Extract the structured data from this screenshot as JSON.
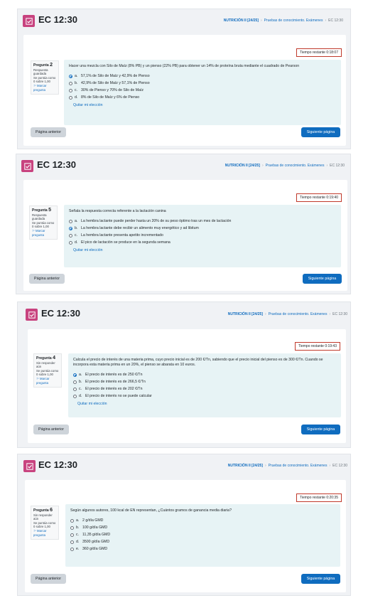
{
  "screens": [
    {
      "title": "EC 12:30",
      "breadcrumb": {
        "course": "NUTRICIÓN II [24/25]",
        "section": "Pruebas de conocimiento. Exámenes",
        "current": "EC 12:30"
      },
      "timer": "Tiempo restante 0:18:07",
      "info": {
        "label": "Pregunta",
        "number": "2",
        "status": "Respuesta guardada",
        "score": "Se puntúa como 0 sobre 1,00",
        "flag": "Marcar pregunta"
      },
      "question": "Hacer una mezcla con Silo de Maíz (8% PB) y un pienso (22% PB) para obtener un 14% de proteína bruta mediante el cuadrado de Pearson",
      "options": [
        {
          "letter": "a.",
          "text": "57,1% de Silo de Maíz y 42,9% de Pienso",
          "selected": true
        },
        {
          "letter": "b.",
          "text": "42,9% de Silo de Maíz y 57,1% de Pienso",
          "selected": false
        },
        {
          "letter": "c.",
          "text": "30% de Pienso y 70% de Silo de Maíz",
          "selected": false
        },
        {
          "letter": "d.",
          "text": "8% de Silo de Maíz y 6% de Pienso",
          "selected": false
        }
      ],
      "clear": "Quitar mi elección",
      "prev": "Página anterior",
      "next": "Siguiente página"
    },
    {
      "title": "EC 12:30",
      "breadcrumb": {
        "course": "NUTRICIÓN II [24/25]",
        "section": "Pruebas de conocimiento. Exámenes",
        "current": "EC 12:30"
      },
      "timer": "Tiempo restante 0:19:40",
      "info": {
        "label": "Pregunta",
        "number": "5",
        "status": "Respuesta guardada",
        "score": "Se puntúa como 0 sobre 1,00",
        "flag": "Marcar pregunta"
      },
      "question": "Señala la respuesta correcta referente a la lactación canina",
      "options": [
        {
          "letter": "a.",
          "text": "La hembra lactante puede perder hasta un 20% de su peso óptimo tras un mes de lactación",
          "selected": false
        },
        {
          "letter": "b.",
          "text": "La hembra lactante debe recibir un alimento muy energético y ad libitum",
          "selected": true
        },
        {
          "letter": "c.",
          "text": "La hembra lactante presenta apetito incrementado",
          "selected": false
        },
        {
          "letter": "d.",
          "text": "El pico de lactación se produce en la segunda semana",
          "selected": false
        }
      ],
      "clear": "Quitar mi elección",
      "prev": "Página anterior",
      "next": "Siguiente página"
    },
    {
      "title": "EC 12:30",
      "breadcrumb": {
        "course": "NUTRICIÓN II [24/25]",
        "section": "Pruebas de conocimiento. Exámenes",
        "current": "EC 12:30"
      },
      "timer": "Tiempo restante 0:19:43",
      "info": {
        "label": "Pregunta",
        "number": "4",
        "status": "Sin responder aún",
        "score": "Se puntúa como 0 sobre 1,00",
        "flag": "Marcar pregunta"
      },
      "question": "Calcula el precio de interés de una materia prima, cuyo precio inicial es de 200 €/Tn, sabiendo que el precio inicial del pienso es de 300 €/Tn. Cuando se incorpora esta materia prima en un 20%, el pienso se abarata en 10 euros.",
      "options": [
        {
          "letter": "a.",
          "text": "El precio de interés es de 250 €/Tn",
          "selected": true
        },
        {
          "letter": "b.",
          "text": "El precio de interés es de 266,5 €/Tn",
          "selected": false
        },
        {
          "letter": "c.",
          "text": "El precio de interés es de 202 €/Tn",
          "selected": false
        },
        {
          "letter": "d.",
          "text": "El precio de interés no se puede calcular",
          "selected": false
        }
      ],
      "clear": "Quitar mi elección",
      "prev": "Página anterior",
      "next": "Siguiente página"
    },
    {
      "title": "EC 12:30",
      "breadcrumb": {
        "course": "NUTRICIÓN II [24/25]",
        "section": "Pruebas de conocimiento. Exámenes",
        "current": "EC 12:30"
      },
      "timer": "Tiempo restante 0:20:35",
      "info": {
        "label": "Pregunta",
        "number": "6",
        "status": "Sin responder aún",
        "score": "Se puntúa como 0 sobre 1,00",
        "flag": "Marcar pregunta"
      },
      "question": "Según algunos autores, 100 kcal de EN representan, ¿Cuántos gramos de ganancia media diaria?",
      "options": [
        {
          "letter": "a.",
          "text": "2 g/día GMD",
          "selected": false
        },
        {
          "letter": "b.",
          "text": "100 g/día GMD",
          "selected": false
        },
        {
          "letter": "c.",
          "text": "11,35 g/día GMD",
          "selected": false
        },
        {
          "letter": "d.",
          "text": "3500 g/día GMD",
          "selected": false
        },
        {
          "letter": "e.",
          "text": "360 g/día GMD",
          "selected": false
        }
      ],
      "clear": "",
      "prev": "Página anterior",
      "next": "Siguiente página"
    }
  ],
  "colors": {
    "accent": "#0f6cbf",
    "quiz_icon": "#c8437f",
    "question_bg": "#e7f3f5",
    "timer_border": "#c0392b"
  },
  "icons": {
    "quiz": "quiz-checkbox-icon"
  }
}
